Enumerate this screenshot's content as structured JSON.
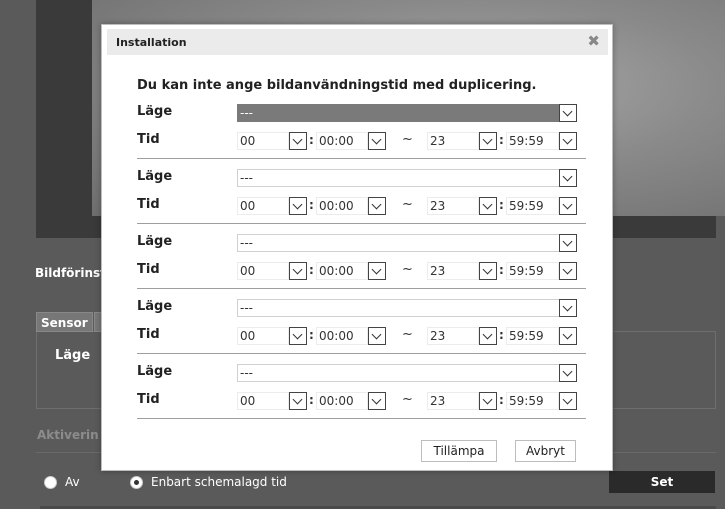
{
  "background": {
    "heading": "Bildförinst",
    "tab_sensor": "Sensor",
    "mode_label": "Läge",
    "activation_label": "Aktiverin",
    "radio_off": "Av",
    "radio_schedule": "Enbart schemalagd tid",
    "set_button": "Set"
  },
  "dialog": {
    "title": "Installation",
    "notice": "Du kan inte ange bildanvändningstid med duplicering.",
    "mode_label": "Läge",
    "time_label": "Tid",
    "colon": ":",
    "tilde": "~",
    "rows": [
      {
        "mode": "---",
        "start_hour": "00",
        "start_time": "00:00",
        "end_hour": "23",
        "end_time": "59:59"
      },
      {
        "mode": "---",
        "start_hour": "00",
        "start_time": "00:00",
        "end_hour": "23",
        "end_time": "59:59"
      },
      {
        "mode": "---",
        "start_hour": "00",
        "start_time": "00:00",
        "end_hour": "23",
        "end_time": "59:59"
      },
      {
        "mode": "---",
        "start_hour": "00",
        "start_time": "00:00",
        "end_hour": "23",
        "end_time": "59:59"
      },
      {
        "mode": "---",
        "start_hour": "00",
        "start_time": "00:00",
        "end_hour": "23",
        "end_time": "59:59"
      }
    ],
    "apply_button": "Tillämpa",
    "cancel_button": "Avbryt"
  }
}
